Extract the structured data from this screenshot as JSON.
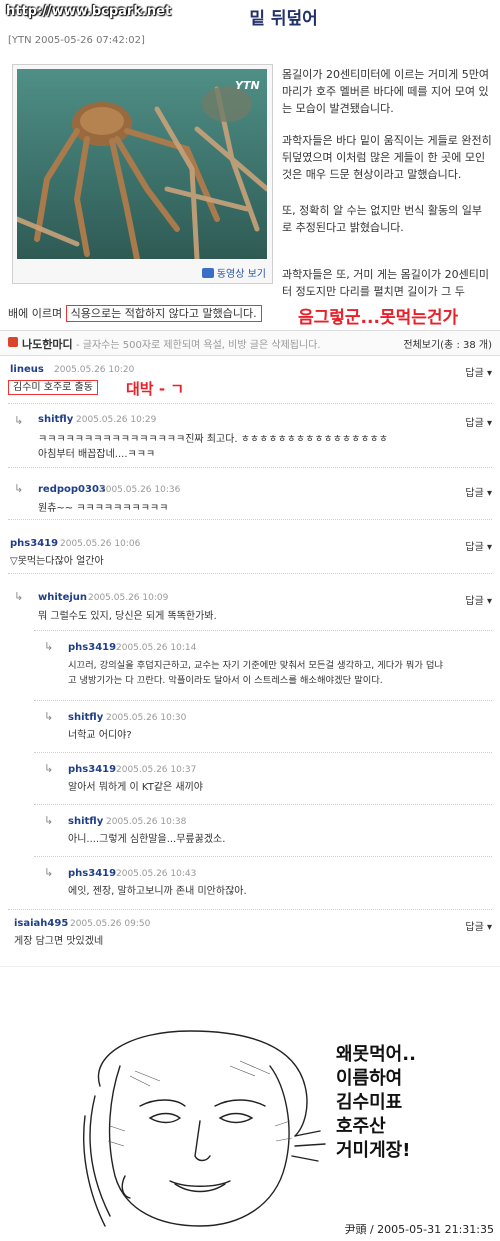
{
  "article": {
    "watermark": "http://www.bcpark.net",
    "title": "밑 뒤덮어",
    "meta": "[YTN   2005-05-26 07:42:02]",
    "video_button": "동영상 보기",
    "image_logo": "YTN",
    "paragraphs": [
      "몸길이가 20센티미터에 이르는 거미게 5만여 마리가 호주 멜버른 바다에 떼를 지어 모여 있는 모습이 발견됐습니다.",
      "과학자들은 바다 밑이 움직이는 게들로 완전히 뒤덮였으며 이처럼 많은 게들이 한 곳에 모인 것은 매우 드문 현상이라고 말했습니다.",
      "또, 정확히 알 수는 없지만 번식 활동의 일부로 추정된다고 밝혔습니다.",
      "과학자들은 또, 거미 게는 몸길이가 20센티미터 정도지만 다리를 펼치면 길이가 그 두"
    ],
    "last_line_prefix": "배에 이르며",
    "last_line_highlight": "식용으로는 적합하지 않다고 말했습니다.",
    "annotation": "음그렇군...못먹는건가"
  },
  "comments_header": {
    "title": "나도한마디",
    "note": "- 글자수는 500자로 제한되며 욕설, 비방 글은 삭제됩니다.",
    "all_view": "전체보기(총 : 38 개)"
  },
  "reply_label": "답글 ▾",
  "comments": [
    {
      "author": "lineus",
      "date": "2005.05.26 10:20",
      "text": "김수미 호주로 출동",
      "annotation": "대박 - ㄱ"
    },
    {
      "author": "shitfly",
      "date": "2005.05.26 10:29",
      "text": "ㅋㅋㅋㅋㅋㅋㅋㅋㅋㅋㅋㅋㅋㅋㅋㅋ진짜 최고다. ㅎㅎㅎㅎㅎㅎㅎㅎㅎㅎㅎㅎㅎㅎㅎㅎ",
      "text2": "아침부터 배꼽잡네....ㅋㅋㅋ"
    },
    {
      "author": "redpop0303",
      "date": "2005.05.26 10:36",
      "text": "원츄~~ ㅋㅋㅋㅋㅋㅋㅋㅋㅋㅋ"
    },
    {
      "author": "phs3419",
      "date": "2005.05.26 10:06",
      "text": "▽못먹는다잖아 얼간아"
    },
    {
      "author": "whitejun",
      "date": "2005.05.26 10:09",
      "text": "뭐 그럴수도 있지, 당신은 되게 똑똑한가봐."
    },
    {
      "author": "phs3419",
      "date": "2005.05.26 10:14",
      "text": "시끄러, 강의실을 후덥지근하고, 교수는 자기 기준에만 맞춰서 모든걸 생각하고, 게다가 뭐가 덥냐",
      "text2": "고 냉방기가는 다 끄란다. 악플이라도 달아서 이 스트레스를 해소해야겠단 말이다."
    },
    {
      "author": "shitfly",
      "date": "2005.05.26 10:30",
      "text": "너학교 어디야?"
    },
    {
      "author": "phs3419",
      "date": "2005.05.26 10:37",
      "text": "알아서 뭐하게 이 KT같은 새끼야"
    },
    {
      "author": "shitfly",
      "date": "2005.05.26 10:38",
      "text": "아니....그렇게 심한말을...무릎꿇겠소."
    },
    {
      "author": "phs3419",
      "date": "2005.05.26 10:43",
      "text": "에잇, 젠장, 말하고보니까 존내 미안하잖아."
    },
    {
      "author": "isaiah495",
      "date": "2005.05.26 09:50",
      "text": "게장 담그면 맛있겠네"
    }
  ],
  "bubble": [
    "왜못먹어..",
    "이름하여",
    "김수미표",
    "호주산",
    "거미게장!"
  ],
  "footer": "尹頭 / 2005-05-31 21:31:35"
}
